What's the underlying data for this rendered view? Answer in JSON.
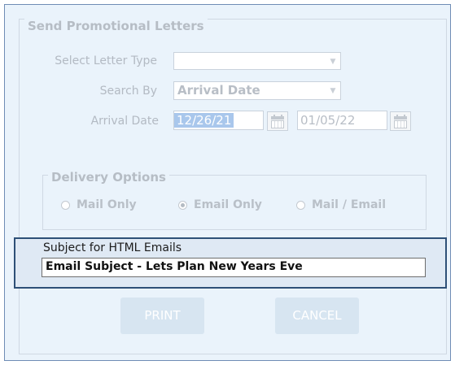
{
  "form": {
    "title": "Send Promotional Letters",
    "letter_type": {
      "label": "Select Letter Type",
      "value": ""
    },
    "search_by": {
      "label": "Search By",
      "value": "Arrival Date"
    },
    "arrival_date": {
      "label": "Arrival Date",
      "start": "12/26/21",
      "end": "01/05/22"
    }
  },
  "delivery": {
    "title": "Delivery  Options",
    "options": [
      {
        "label": "Mail Only",
        "selected": false
      },
      {
        "label": "Email Only",
        "selected": true
      },
      {
        "label": "Mail / Email",
        "selected": false
      }
    ]
  },
  "subject": {
    "label": "Subject for HTML Emails",
    "value": "Email Subject - Lets Plan New Years Eve"
  },
  "buttons": {
    "print": "PRINT",
    "cancel": "CANCEL"
  },
  "colors": {
    "window_bg": "#eaf3fb",
    "disabled_text": "#b3bac3",
    "highlight_border": "#2e5077",
    "selection_bg": "#a9c7ec"
  },
  "icons": [
    "dropdown-arrow-icon",
    "calendar-icon",
    "radio-icon"
  ]
}
